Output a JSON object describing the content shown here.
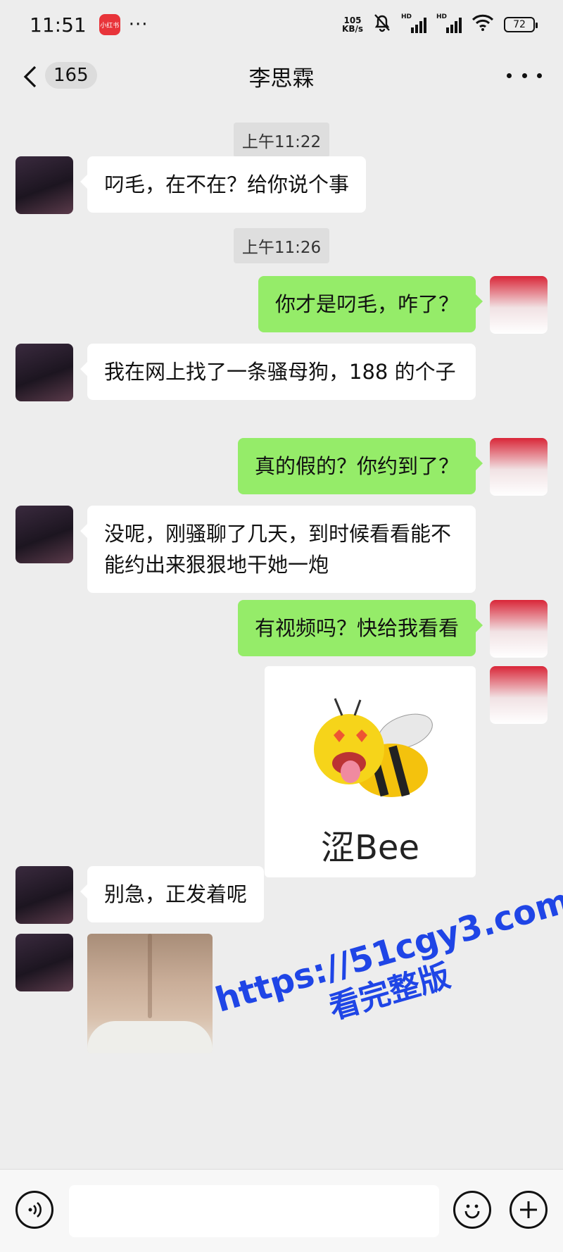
{
  "status_bar": {
    "time": "11:51",
    "app_badge": "小红书",
    "more": "···",
    "net_speed_value": "105",
    "net_speed_unit": "KB/s",
    "signal_label_1": "HD",
    "signal_label_2": "HD",
    "battery": "72"
  },
  "nav": {
    "unread_count": "165",
    "title": "李思霖"
  },
  "messages": [
    {
      "type": "timestamp",
      "text": "上午11:22"
    },
    {
      "type": "text",
      "side": "left",
      "text": "叼毛，在不在？给你说个事"
    },
    {
      "type": "timestamp",
      "text": "上午11:26"
    },
    {
      "type": "text",
      "side": "right",
      "text": "你才是叼毛，咋了？"
    },
    {
      "type": "text",
      "side": "left",
      "text": "我在网上找了一条骚母狗，188 的个子"
    },
    {
      "type": "text",
      "side": "right",
      "text": "真的假的？你约到了？"
    },
    {
      "type": "text",
      "side": "left",
      "text": "没呢，刚骚聊了几天，到时候看看能不能约出来狠狠地干她一炮"
    },
    {
      "type": "text",
      "side": "right",
      "text": "有视频吗？快给我看看"
    },
    {
      "type": "sticker",
      "side": "right",
      "caption": "涩Bee"
    },
    {
      "type": "text",
      "side": "left",
      "text": "别急，正发着呢"
    },
    {
      "type": "image",
      "side": "left"
    }
  ],
  "watermark": {
    "line1": "https://51cgy3.com",
    "line2": "看完整版"
  },
  "input": {
    "placeholder": ""
  },
  "colors": {
    "background": "#ededed",
    "bubble_self": "#95ec69",
    "bubble_other": "#ffffff",
    "watermark": "#1f45e6"
  }
}
